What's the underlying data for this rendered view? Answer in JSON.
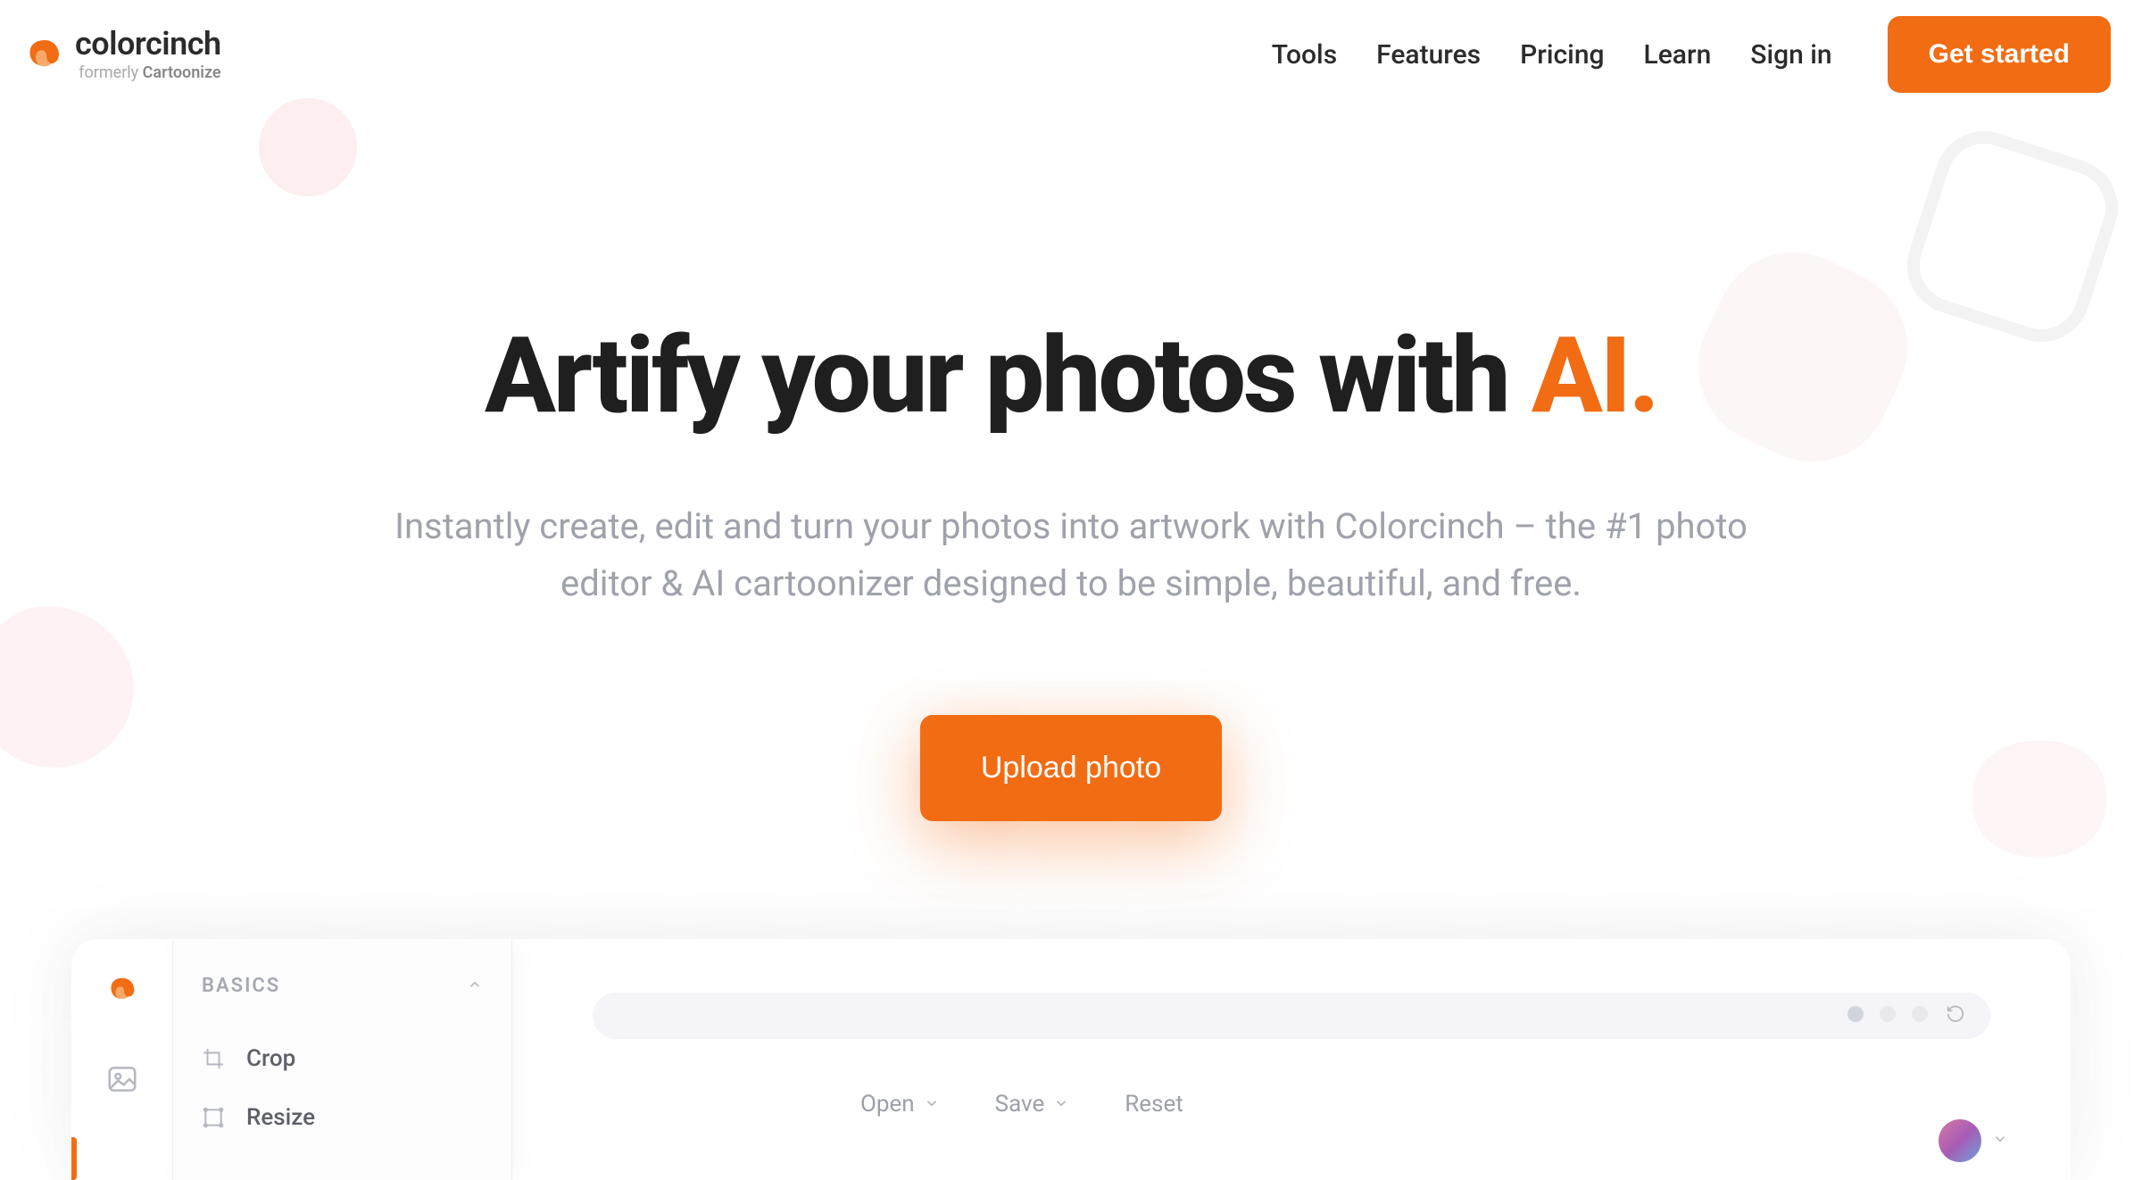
{
  "header": {
    "brand": "colorcinch",
    "subbrand_prefix": "formerly ",
    "subbrand_name": "Cartoonize",
    "nav": {
      "tools": "Tools",
      "features": "Features",
      "pricing": "Pricing",
      "learn": "Learn",
      "signin": "Sign in"
    },
    "cta": "Get started"
  },
  "hero": {
    "title_prefix": "Artify your photos with ",
    "title_accent": "AI.",
    "subtitle": "Instantly create, edit and turn your photos into artwork with Colorcinch – the #1 photo editor & AI cartoonizer designed to be simple, beautiful, and free.",
    "cta": "Upload photo"
  },
  "editor": {
    "panel_title": "BASICS",
    "items": {
      "crop": "Crop",
      "resize": "Resize"
    },
    "toolbar": {
      "open": "Open",
      "save": "Save",
      "reset": "Reset"
    }
  },
  "colors": {
    "accent": "#f26c13"
  }
}
